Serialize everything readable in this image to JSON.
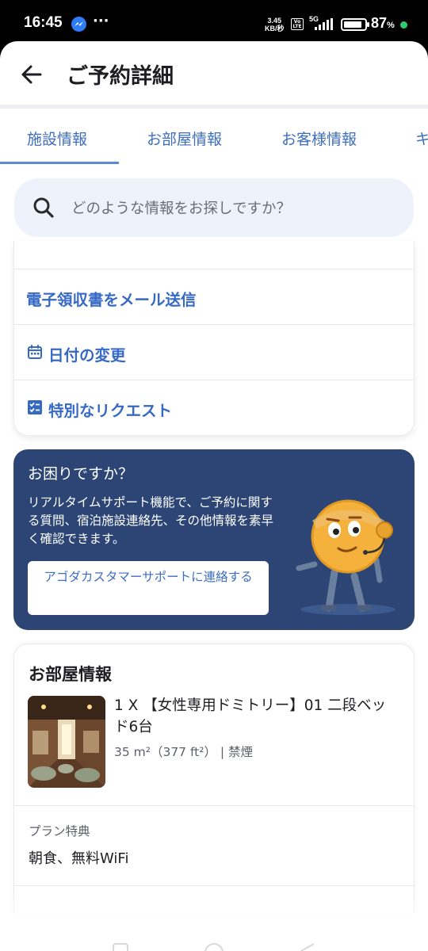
{
  "status_bar": {
    "time": "16:45",
    "dots": "···",
    "speed_value": "3.45",
    "speed_unit": "KB/秒",
    "volte": "Vo LTE",
    "network": "5G",
    "battery_percent": "87",
    "battery_unit": "%",
    "battery_level": 0.87
  },
  "header": {
    "title": "ご予約詳細"
  },
  "tabs": [
    {
      "label": "施設情報",
      "active": true
    },
    {
      "label": "お部屋情報",
      "active": false
    },
    {
      "label": "お客様情報",
      "active": false
    },
    {
      "label": "キ",
      "active": false
    }
  ],
  "search": {
    "placeholder": "どのような情報をお探しですか？"
  },
  "options": {
    "receipt_label": "電子領収書をメール送信",
    "change_date_label": "日付の変更",
    "special_request_label": "特別なリクエスト"
  },
  "help": {
    "title": "お困りですか？",
    "body": "リアルタイムサポート機能で、ご予約に関する質問、宿泊施設連絡先、その他情報を素早く確認できます。",
    "button_label": "アゴダカスタマーサポートに連絡する"
  },
  "room": {
    "section_title": "お部屋情報",
    "name": "1 X 【女性専用ドミトリー】01 二段ベッド6台",
    "size": "35 m²（377 ft²） | 禁煙",
    "plan_label": "プラン特典",
    "plan_value": "朝食、無料WiFi"
  },
  "colors": {
    "accent": "#3669c4",
    "help_bg": "#2c4575",
    "search_bg": "#eef3fb"
  }
}
